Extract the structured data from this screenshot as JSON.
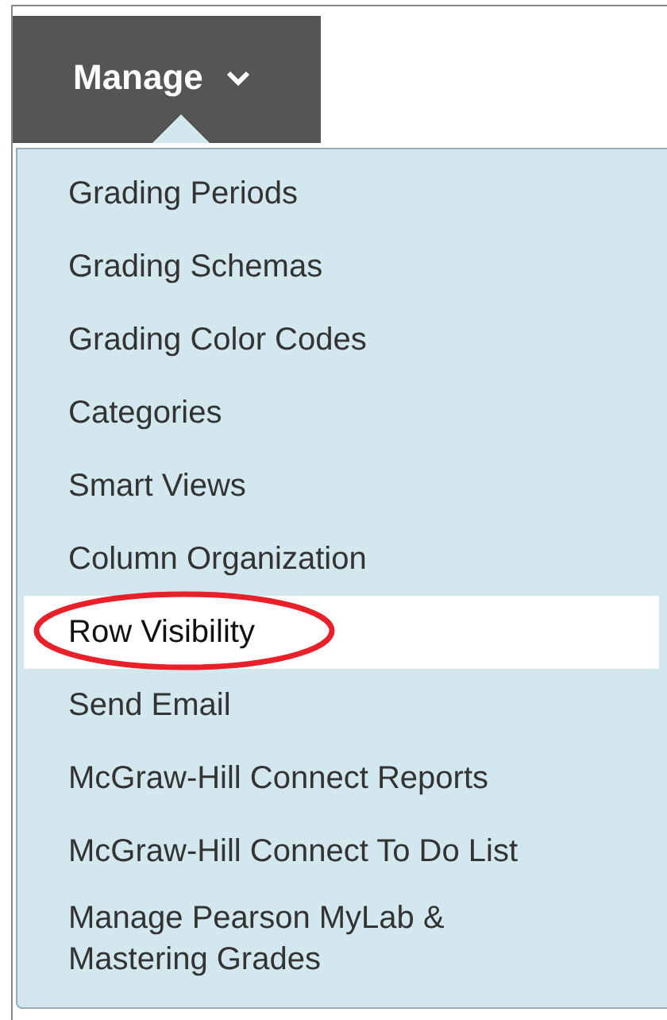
{
  "menu_button": {
    "label": "Manage",
    "expanded": true
  },
  "menu_items": [
    {
      "label": "Grading Periods",
      "selected": false,
      "circled": false
    },
    {
      "label": "Grading Schemas",
      "selected": false,
      "circled": false
    },
    {
      "label": "Grading Color Codes",
      "selected": false,
      "circled": false
    },
    {
      "label": "Categories",
      "selected": false,
      "circled": false
    },
    {
      "label": "Smart Views",
      "selected": false,
      "circled": false
    },
    {
      "label": "Column Organization",
      "selected": false,
      "circled": false
    },
    {
      "label": "Row Visibility",
      "selected": true,
      "circled": true
    },
    {
      "label": "Send Email",
      "selected": false,
      "circled": false
    },
    {
      "label": "McGraw-Hill Connect Reports",
      "selected": false,
      "circled": false
    },
    {
      "label": "McGraw-Hill Connect To Do List",
      "selected": false,
      "circled": false
    },
    {
      "label": "Manage Pearson MyLab & Mastering Grades",
      "selected": false,
      "circled": false
    }
  ]
}
